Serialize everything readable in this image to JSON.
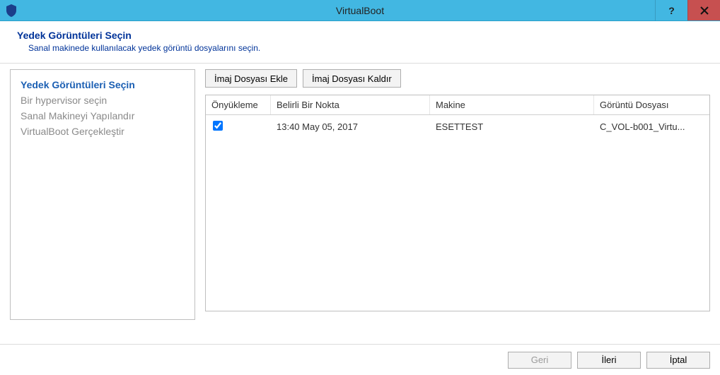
{
  "window": {
    "title": "VirtualBoot"
  },
  "header": {
    "title": "Yedek Görüntüleri Seçin",
    "subtitle": "Sanal makinede kullanılacak yedek görüntü dosyalarını seçin."
  },
  "sidebar": {
    "steps": [
      {
        "label": "Yedek Görüntüleri Seçin",
        "active": true
      },
      {
        "label": "Bir hypervisor seçin",
        "active": false
      },
      {
        "label": "Sanal Makineyi Yapılandır",
        "active": false
      },
      {
        "label": "VirtualBoot Gerçekleştir",
        "active": false
      }
    ]
  },
  "toolbar": {
    "add_image": "İmaj Dosyası Ekle",
    "remove_image": "İmaj Dosyası Kaldır"
  },
  "grid": {
    "columns": {
      "boot": "Önyükleme",
      "point": "Belirli Bir Nokta",
      "machine": "Makine",
      "file": "Görüntü Dosyası"
    },
    "rows": [
      {
        "boot_checked": true,
        "point": "13:40 May 05, 2017",
        "machine": "ESETTEST",
        "file": "C_VOL-b001_Virtu..."
      }
    ]
  },
  "footer": {
    "back": "Geri",
    "next": "İleri",
    "cancel": "İptal"
  }
}
